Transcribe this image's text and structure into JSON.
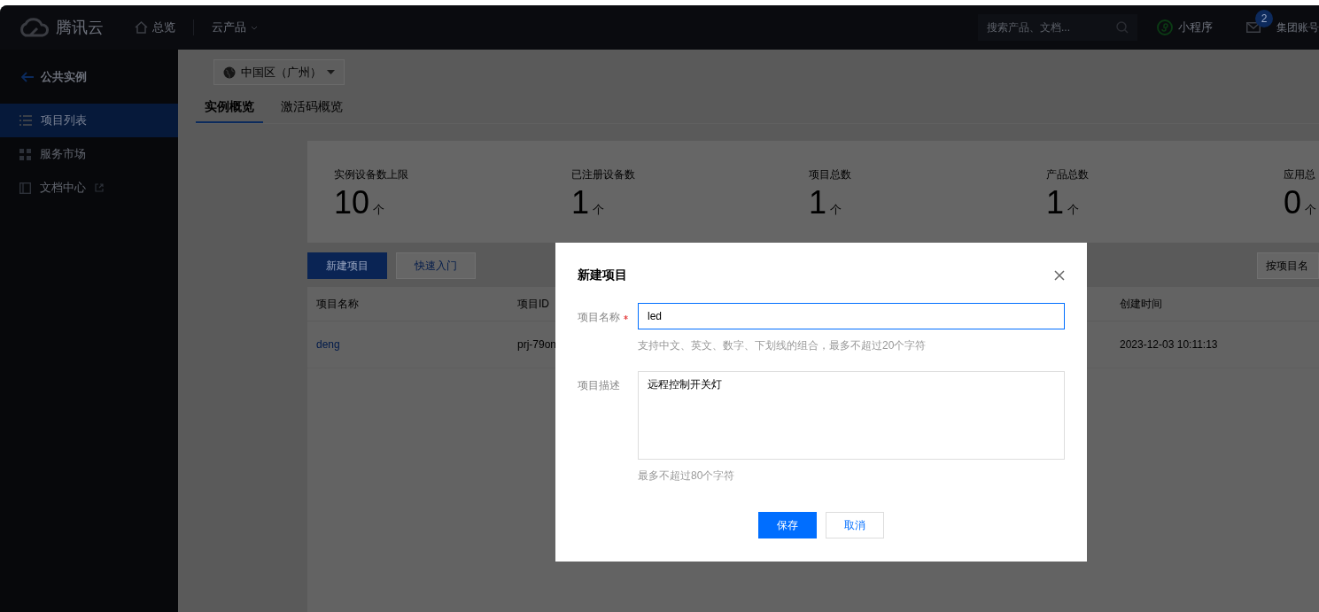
{
  "top_bar": {
    "brand": "腾讯云",
    "nav": [
      {
        "label": "总览",
        "kind": "home"
      },
      {
        "label": "云产品",
        "kind": "dropdown"
      }
    ],
    "search": {
      "placeholder": "搜索产品、文档..."
    },
    "mini_program": "小程序",
    "notification_badge": "2",
    "account": "集团账号"
  },
  "sidebar": {
    "back": "公共实例",
    "items": [
      {
        "label": "项目列表",
        "kind": "list",
        "selected": true,
        "external": false
      },
      {
        "label": "服务市场",
        "kind": "grid",
        "selected": false,
        "external": false
      },
      {
        "label": "文档中心",
        "kind": "book",
        "selected": false,
        "external": true
      }
    ]
  },
  "region_select": {
    "value": "中国区（广州）"
  },
  "tabs": [
    {
      "label": "实例概览",
      "selected": true
    },
    {
      "label": "激活码概览",
      "selected": false
    }
  ],
  "stats": [
    {
      "label": "实例设备数上限",
      "value": "10",
      "unit": "个"
    },
    {
      "label": "已注册设备数",
      "value": "1",
      "unit": "个"
    },
    {
      "label": "项目总数",
      "value": "1",
      "unit": "个"
    },
    {
      "label": "产品总数",
      "value": "1",
      "unit": "个"
    },
    {
      "label": "应用总",
      "value": "0",
      "unit": "个"
    }
  ],
  "actions": [
    {
      "label": "新建项目",
      "kind": "primary"
    },
    {
      "label": "快速入门",
      "kind": "secondary"
    }
  ],
  "filter": {
    "value": "按项目名"
  },
  "table": {
    "columns": [
      {
        "label": "项目名称"
      },
      {
        "label": "项目ID"
      },
      {
        "label": "创建时间"
      }
    ],
    "rows": [
      {
        "cells": [
          "deng",
          "prj-79on",
          "2023-12-03 10:11:13"
        ]
      }
    ]
  },
  "dialog": {
    "title": "新建项目",
    "fields": [
      {
        "label": "项目名称",
        "required": true,
        "kind": "input",
        "value": "led",
        "focused": true,
        "hint": "支持中文、英文、数字、下划线的组合，最多不超过20个字符"
      },
      {
        "label": "项目描述",
        "required": false,
        "kind": "textarea",
        "value": "远程控制开关灯",
        "focused": false,
        "hint": "最多不超过80个字符"
      }
    ],
    "buttons": [
      {
        "label": "保存",
        "kind": "primary"
      },
      {
        "label": "取消",
        "kind": "secondary"
      }
    ]
  }
}
